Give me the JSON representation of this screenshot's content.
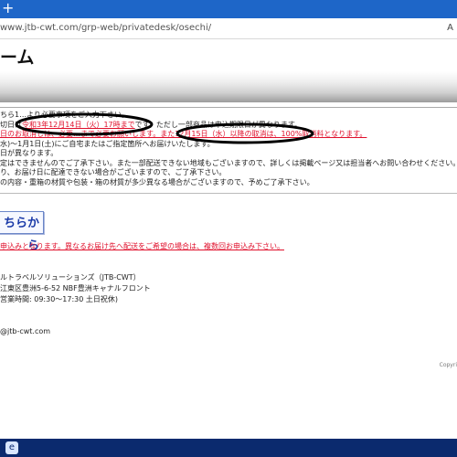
{
  "browser": {
    "new_tab_symbol": "+",
    "address_url": "www.jtb-cwt.com/grp-web/privatedesk/osechi/",
    "address_right_char": "A"
  },
  "page": {
    "title": "ーム",
    "notes": [
      "ちら1…より必要事項をご入力下さい。",
      "切日は令和3年12月14日（火）17時までです。ただし一部商品は申込期限日が異なります。",
      "日のお取消しは、必要…まで必要お願いします。また12月15日（水）以降の取消は、100%取消料となります。",
      "水)〜1月1日(土)にご自宅またはご指定箇所へお届けいたします。",
      "日が異なります。",
      "定はできませんのでご了承下さい。また一部配送できない地域もございますので、詳しくは掲載ページ又は担当者へお問い合わせください。»",
      "り、お届け日に配達できない場合がございますので、ご了承下さい。",
      "の内容・重箱の材質や包装・箱の材質が多少異なる場合がございますので、予めご了承下さい。"
    ],
    "apply_button": "ちらから",
    "apply_note": "申込みとなります。異なるお届け先へ配送をご希望の場合は、複数回お申込み下さい。",
    "company": [
      "ルトラベルソリューションズ（JTB-CWT）",
      "江東区豊洲5-6-52 NBF豊洲キャナルフロント",
      "営業時間: 09:30〜17:30 土日祝休)"
    ],
    "email": "@jtb-cwt.com",
    "copyright": "Copyri"
  },
  "taskbar": {
    "icon": "browser-icon"
  },
  "colors": {
    "tab_bar": "#1e66c8",
    "taskbar": "#0b2a6e",
    "red_text": "#e0102c",
    "annotation": "#000000"
  }
}
